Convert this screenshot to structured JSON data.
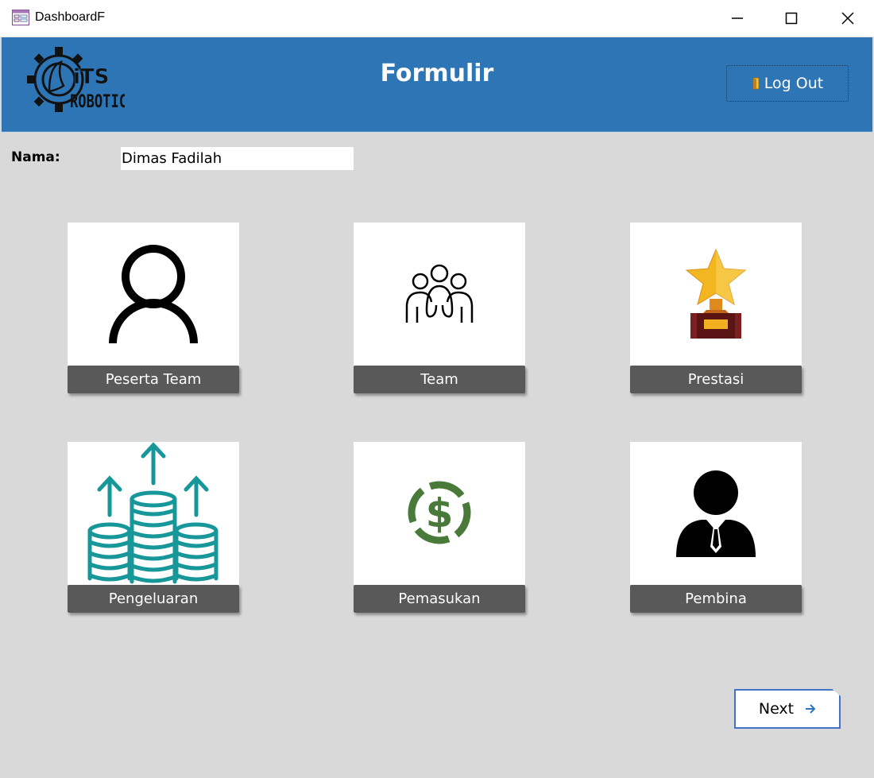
{
  "window": {
    "title": "DashboardF"
  },
  "header": {
    "title": "Formulir",
    "logout_label": "Log Out",
    "logo_text_top": "iTS",
    "logo_text_bottom": "ROBOTICS"
  },
  "form": {
    "nama_label": "Nama:",
    "nama_value": "Dimas Fadilah"
  },
  "menu": [
    {
      "label": "Peserta Team",
      "icon": "person-icon"
    },
    {
      "label": "Team",
      "icon": "group-icon"
    },
    {
      "label": "Prestasi",
      "icon": "trophy-icon"
    },
    {
      "label": "Pengeluaran",
      "icon": "coins-up-icon"
    },
    {
      "label": "Pemasukan",
      "icon": "dollar-circle-icon"
    },
    {
      "label": "Pembina",
      "icon": "businessman-icon"
    }
  ],
  "footer": {
    "next_label": "Next"
  },
  "colors": {
    "header_bg": "#2e75b6",
    "body_bg": "#d9d9d9",
    "card_label_bg": "#595959",
    "next_border": "#4472c4",
    "coins": "#17979a",
    "dollar": "#4a7a3a"
  }
}
